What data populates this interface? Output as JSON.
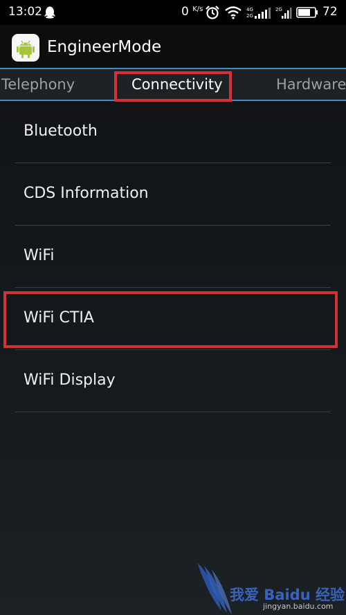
{
  "status_bar": {
    "time": "13:02",
    "net_speed": "0",
    "net_speed_unit": "K/s",
    "signal_1_label_top": "4G",
    "signal_1_label_bottom": "2G",
    "signal_2_label": "2G",
    "battery_level": "72"
  },
  "app_bar": {
    "title": "EngineerMode",
    "icon": "android-icon"
  },
  "tabs": [
    {
      "label": "Telephony",
      "selected": false
    },
    {
      "label": "Connectivity",
      "selected": true
    },
    {
      "label": "Hardware",
      "selected": false
    }
  ],
  "list": {
    "items": [
      {
        "label": "Bluetooth"
      },
      {
        "label": "CDS Information"
      },
      {
        "label": "WiFi"
      },
      {
        "label": "WiFi CTIA",
        "highlighted": true
      },
      {
        "label": "WiFi Display"
      }
    ]
  },
  "watermark": {
    "text": "我爱 Baidu 经验",
    "url": "jingyan.baidu.com"
  },
  "colors": {
    "highlight": "#d2313a",
    "tab_indicator": "#3a8fc6",
    "android_green": "#a4c639",
    "watermark_blue": "#3f6fd6"
  }
}
